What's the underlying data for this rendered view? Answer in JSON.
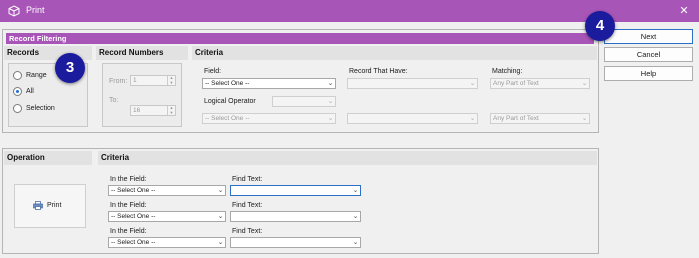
{
  "window": {
    "title": "Print"
  },
  "filtering": {
    "section_title": "Record Filtering",
    "records": {
      "header": "Records",
      "options": [
        "Range",
        "All",
        "Selection"
      ],
      "selected": "All"
    },
    "record_numbers": {
      "header": "Record Numbers",
      "from_label": "From:",
      "from_value": "1",
      "to_label": "To:",
      "to_value": "16"
    },
    "criteria": {
      "header": "Criteria",
      "field_label": "Field:",
      "field_value": "-- Select One --",
      "field2_value": "-- Select One --",
      "record_have_label": "Record That Have:",
      "matching_label": "Matching:",
      "matching_value": "Any Part of Text",
      "matching2_value": "Any Part of Text",
      "logical_operator_label": "Logical Operator"
    }
  },
  "operation": {
    "header": "Operation",
    "print_label": "Print",
    "criteria_header": "Criteria",
    "rows": [
      {
        "field_label": "In the Field:",
        "field_value": "-- Select One --",
        "find_label": "Find Text:"
      },
      {
        "field_label": "In the Field:",
        "field_value": "-- Select One --",
        "find_label": "Find Text:"
      },
      {
        "field_label": "In the Field:",
        "field_value": "-- Select One --",
        "find_label": "Find Text:"
      }
    ]
  },
  "buttons": {
    "next": "Next",
    "cancel": "Cancel",
    "help": "Help"
  },
  "callouts": {
    "badge_3": "3",
    "badge_4": "4"
  },
  "colors": {
    "title_bar": "#a855b8",
    "badge": "#1b1b9e",
    "focus_border": "#2d6fc6"
  },
  "icons": {
    "title": "cube-icon",
    "close": "close-icon",
    "print": "printer-icon",
    "dropdown": "chevron-down-icon"
  }
}
